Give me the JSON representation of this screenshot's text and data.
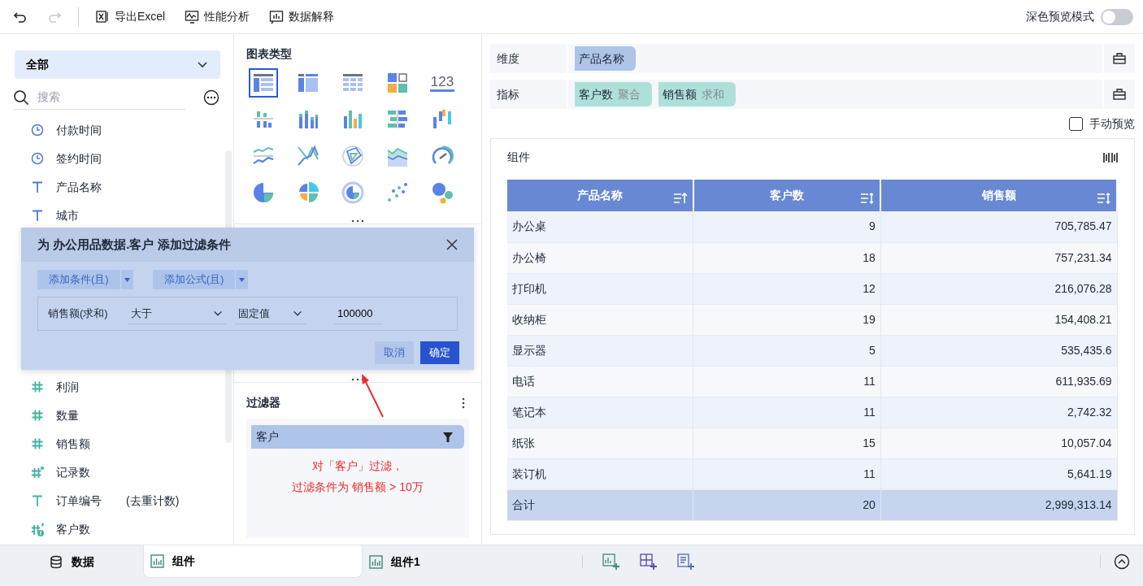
{
  "toolbar": {
    "undo": {
      "disabled": false
    },
    "redo": {
      "disabled": true
    },
    "actions": [
      {
        "kind": "excel",
        "label": "导出Excel"
      },
      {
        "kind": "performance",
        "label": "性能分析"
      },
      {
        "kind": "explain",
        "label": "数据解释"
      }
    ],
    "dark_preview": {
      "label": "深色预览模式",
      "on": false
    }
  },
  "data_panel": {
    "scope": "全部",
    "search": {
      "placeholder": "搜索"
    },
    "fields_above": [
      {
        "kind": "time",
        "color": "#4f78d8",
        "label": "付款时间"
      },
      {
        "kind": "time",
        "color": "#4f78d8",
        "label": "签约时间"
      },
      {
        "kind": "text",
        "color": "#4f78d8",
        "label": "产品名称"
      },
      {
        "kind": "text",
        "color": "#4f78d8",
        "label": "城市"
      }
    ],
    "fields_below": [
      {
        "kind": "number",
        "color": "#3fb3a0",
        "label": "利润"
      },
      {
        "kind": "number",
        "color": "#3fb3a0",
        "label": "数量"
      },
      {
        "kind": "number",
        "color": "#3fb3a0",
        "label": "销售额"
      },
      {
        "kind": "count",
        "color": "#3fb3a0",
        "label": "记录数"
      },
      {
        "kind": "text",
        "color": "#3fb3a0",
        "label": "订单编号",
        "note": "(去重计数)"
      },
      {
        "kind": "formula",
        "color": "#3fb3a0",
        "label": "客户数"
      }
    ]
  },
  "chart_types": {
    "title": "图表类型",
    "items": [
      {
        "kind": "detail-table",
        "selected": true
      },
      {
        "kind": "group-table",
        "selected": false
      },
      {
        "kind": "cross-table",
        "selected": false
      },
      {
        "kind": "multi-card",
        "selected": false
      },
      {
        "kind": "kpi",
        "label": "123",
        "selected": false
      },
      {
        "kind": "bar-split",
        "selected": false
      },
      {
        "kind": "bar-stack",
        "selected": false
      },
      {
        "kind": "bar-multi",
        "selected": false
      },
      {
        "kind": "bar-horizontal",
        "selected": false
      },
      {
        "kind": "bar-range",
        "selected": false
      },
      {
        "kind": "line-split",
        "selected": false
      },
      {
        "kind": "line",
        "selected": false
      },
      {
        "kind": "radar",
        "selected": false
      },
      {
        "kind": "area",
        "selected": false
      },
      {
        "kind": "gauge",
        "selected": false
      },
      {
        "kind": "pie",
        "selected": false
      },
      {
        "kind": "rose",
        "selected": false
      },
      {
        "kind": "ring",
        "selected": false
      },
      {
        "kind": "scatter",
        "selected": false
      },
      {
        "kind": "bubble",
        "selected": false
      }
    ]
  },
  "dialog": {
    "title": "为 办公用品数据.客户 添加过滤条件",
    "add_buttons": [
      {
        "label": "添加条件(且)"
      },
      {
        "label": "添加公式(且)"
      }
    ],
    "condition": {
      "field": "销售额(求和)",
      "operator": "大于",
      "value_type": "固定值",
      "value": "100000"
    },
    "cancel": "取消",
    "ok": "确定"
  },
  "filter": {
    "title": "过滤器",
    "items": [
      {
        "label": "客户"
      }
    ],
    "note": [
      "对「客户」过滤，",
      "过滤条件为 销售额 > 10万"
    ]
  },
  "dimension": {
    "label": "维度",
    "chips": [
      {
        "name": "产品名称"
      }
    ]
  },
  "metric": {
    "label": "指标",
    "chips": [
      {
        "name": "客户数",
        "agg": "聚合"
      },
      {
        "name": "销售额",
        "agg": "求和"
      }
    ]
  },
  "manual_preview": {
    "label": "手动预览",
    "checked": false
  },
  "widget": {
    "title": "组件",
    "table": {
      "columns": [
        {
          "label": "产品名称",
          "kind": "ascending"
        },
        {
          "label": "客户数",
          "kind": "unsorted"
        },
        {
          "label": "销售额",
          "kind": "unsorted"
        }
      ],
      "rows": [
        [
          "办公桌",
          "9",
          "705,785.47"
        ],
        [
          "办公椅",
          "18",
          "757,231.34"
        ],
        [
          "打印机",
          "12",
          "216,076.28"
        ],
        [
          "收纳柜",
          "19",
          "154,408.21"
        ],
        [
          "显示器",
          "5",
          "535,435.6"
        ],
        [
          "电话",
          "11",
          "611,935.69"
        ],
        [
          "笔记本",
          "11",
          "2,742.32"
        ],
        [
          "纸张",
          "15",
          "10,057.04"
        ],
        [
          "装订机",
          "11",
          "5,641.19"
        ]
      ],
      "total": [
        "合计",
        "20",
        "2,999,313.14"
      ]
    }
  },
  "bottom_tabs": [
    {
      "kind": "data",
      "label": "数据",
      "selected": false
    },
    {
      "kind": "widget",
      "label": "组件",
      "selected": true
    },
    {
      "kind": "widget",
      "label": "组件1",
      "selected": false
    }
  ]
}
